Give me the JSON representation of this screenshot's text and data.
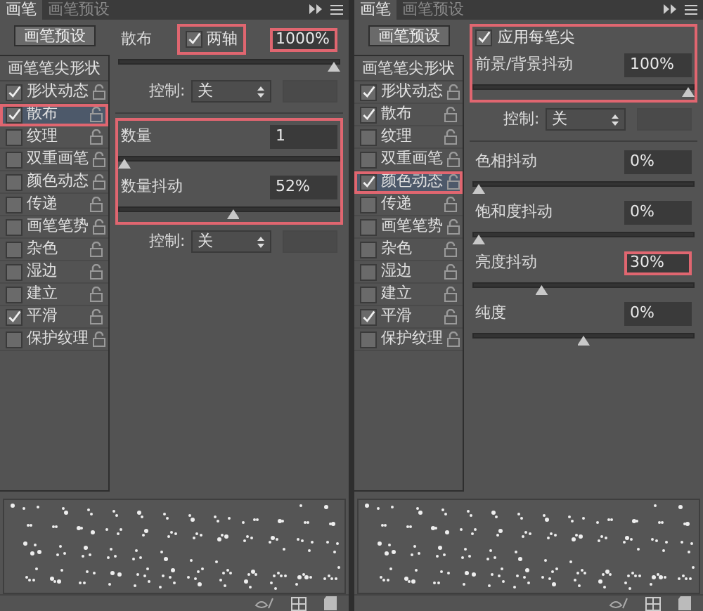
{
  "panels": [
    {
      "tabs": [
        {
          "label": "画笔",
          "selected": true
        },
        {
          "label": "画笔预设",
          "selected": false
        }
      ],
      "preset_button": "画笔预设",
      "list_header": "画笔笔尖形状",
      "items": [
        {
          "label": "形状动态",
          "checked": true,
          "selected": false,
          "highlighted": false
        },
        {
          "label": "散布",
          "checked": true,
          "selected": true,
          "highlighted": true
        },
        {
          "label": "纹理",
          "checked": false,
          "selected": false,
          "highlighted": false
        },
        {
          "label": "双重画笔",
          "checked": false,
          "selected": false,
          "highlighted": false
        },
        {
          "label": "颜色动态",
          "checked": false,
          "selected": false,
          "highlighted": false
        },
        {
          "label": "传递",
          "checked": false,
          "selected": false,
          "highlighted": false
        },
        {
          "label": "画笔笔势",
          "checked": false,
          "selected": false,
          "highlighted": false
        },
        {
          "label": "杂色",
          "checked": false,
          "selected": false,
          "highlighted": false
        },
        {
          "label": "湿边",
          "checked": false,
          "selected": false,
          "highlighted": false
        },
        {
          "label": "建立",
          "checked": false,
          "selected": false,
          "highlighted": false
        },
        {
          "label": "平滑",
          "checked": true,
          "selected": false,
          "highlighted": false
        },
        {
          "label": "保护纹理",
          "checked": false,
          "selected": false,
          "highlighted": false
        }
      ],
      "settings": [
        {
          "kind": "field",
          "label": "散布",
          "value": "1000%",
          "highlighted": true,
          "checkbox": {
            "label": "两轴",
            "checked": true,
            "highlighted": true
          }
        },
        {
          "kind": "slider",
          "level": 1
        },
        {
          "kind": "control",
          "label": "控制:",
          "value": "关"
        },
        {
          "kind": "divider"
        },
        {
          "kind": "group",
          "highlighted": true,
          "children": [
            {
              "kind": "field",
              "label": "数量",
              "value": "1",
              "highlighted": false
            },
            {
              "kind": "slider",
              "level": 0
            },
            {
              "kind": "field",
              "label": "数量抖动",
              "value": "52%",
              "highlighted": false
            },
            {
              "kind": "slider",
              "level": 0.52
            }
          ]
        },
        {
          "kind": "control",
          "label": "控制:",
          "value": "关"
        }
      ]
    },
    {
      "tabs": [
        {
          "label": "画笔",
          "selected": true
        },
        {
          "label": "画笔预设",
          "selected": false
        }
      ],
      "preset_button": "画笔预设",
      "list_header": "画笔笔尖形状",
      "items": [
        {
          "label": "形状动态",
          "checked": true,
          "selected": false,
          "highlighted": false
        },
        {
          "label": "散布",
          "checked": true,
          "selected": false,
          "highlighted": false
        },
        {
          "label": "纹理",
          "checked": false,
          "selected": false,
          "highlighted": false
        },
        {
          "label": "双重画笔",
          "checked": false,
          "selected": false,
          "highlighted": false
        },
        {
          "label": "颜色动态",
          "checked": true,
          "selected": true,
          "highlighted": true
        },
        {
          "label": "传递",
          "checked": false,
          "selected": false,
          "highlighted": false
        },
        {
          "label": "画笔笔势",
          "checked": false,
          "selected": false,
          "highlighted": false
        },
        {
          "label": "杂色",
          "checked": false,
          "selected": false,
          "highlighted": false
        },
        {
          "label": "湿边",
          "checked": false,
          "selected": false,
          "highlighted": false
        },
        {
          "label": "建立",
          "checked": false,
          "selected": false,
          "highlighted": false
        },
        {
          "label": "平滑",
          "checked": true,
          "selected": false,
          "highlighted": false
        },
        {
          "label": "保护纹理",
          "checked": false,
          "selected": false,
          "highlighted": false
        }
      ],
      "settings": [
        {
          "kind": "group",
          "highlighted": true,
          "children": [
            {
              "kind": "checkbox",
              "label": "应用每笔尖",
              "checked": true
            },
            {
              "kind": "field",
              "label": "前景/背景抖动",
              "value": "100%",
              "highlighted": false
            },
            {
              "kind": "slider",
              "level": 1
            }
          ]
        },
        {
          "kind": "control",
          "label": "控制:",
          "value": "关"
        },
        {
          "kind": "divider"
        },
        {
          "kind": "field",
          "label": "色相抖动",
          "value": "0%",
          "highlighted": false
        },
        {
          "kind": "slider",
          "level": 0
        },
        {
          "kind": "field",
          "label": "饱和度抖动",
          "value": "0%",
          "highlighted": false
        },
        {
          "kind": "slider",
          "level": 0
        },
        {
          "kind": "field",
          "label": "亮度抖动",
          "value": "30%",
          "highlighted": true
        },
        {
          "kind": "slider",
          "level": 0.3
        },
        {
          "kind": "field",
          "label": "纯度",
          "value": "0%",
          "highlighted": false
        },
        {
          "kind": "slider",
          "level": 0.5
        }
      ]
    }
  ]
}
